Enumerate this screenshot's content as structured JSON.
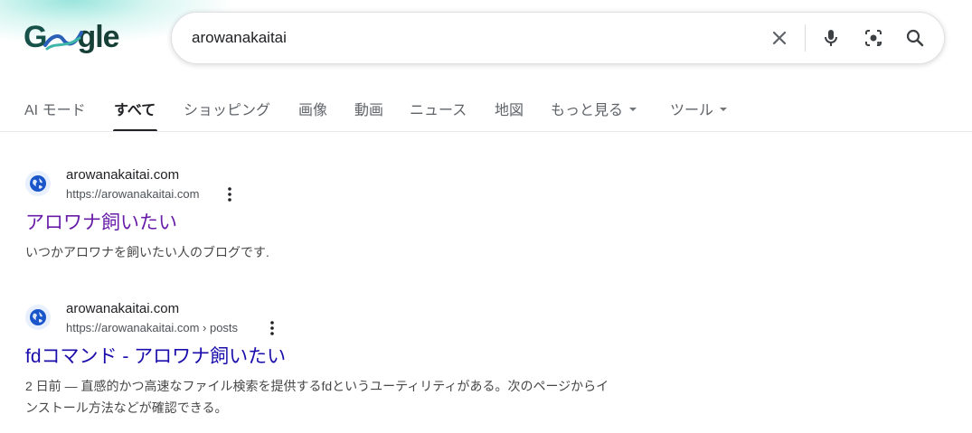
{
  "logo": {
    "text_g": "G",
    "text_rest": "gle"
  },
  "search": {
    "query": "arowanakaitai"
  },
  "icons": {
    "clear": "close-icon",
    "mic": "mic-icon",
    "lens": "camera-lens-icon",
    "search": "search-icon"
  },
  "tabs": [
    {
      "label": "AI モード"
    },
    {
      "label": "すべて"
    },
    {
      "label": "ショッピング"
    },
    {
      "label": "画像"
    },
    {
      "label": "動画"
    },
    {
      "label": "ニュース"
    },
    {
      "label": "地図"
    },
    {
      "label": "もっと見る"
    },
    {
      "label": "ツール"
    }
  ],
  "results": [
    {
      "site_name": "arowanakaitai.com",
      "url": "https://arowanakaitai.com",
      "title": "アロワナ飼いたい",
      "snippet": "いつかアロワナを飼いたい人のブログです."
    },
    {
      "site_name": "arowanakaitai.com",
      "url": "https://arowanakaitai.com › posts",
      "title": "fdコマンド - アロワナ飼いたい",
      "snippet_line1": "2 日前 — 直感的かつ高速なファイル検索を提供するfdというユーティリティがある。次のページからイ",
      "snippet_line2": "ンストール方法などが確認できる。"
    }
  ],
  "colors": {
    "visited": "#681da8",
    "link": "#1a0dab",
    "active_tab": "#202124"
  }
}
